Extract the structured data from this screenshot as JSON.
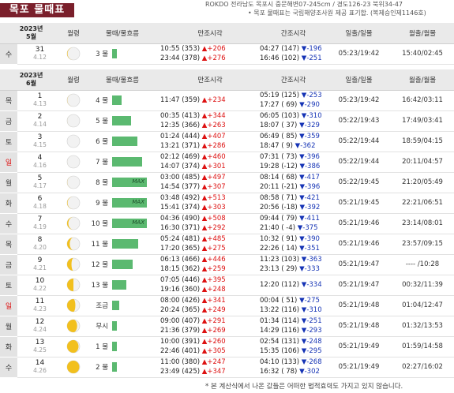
{
  "title": "목포 물때표",
  "header_info": "ROKDO 전라남도 목포시 중문해변07-245cm / 경도126-23 북위34-47",
  "header_note": "• 목포 물때표는 국립해양조사원 제공 표기합. (복제승인제1146호)",
  "columns": {
    "moon": "월령",
    "tide": "물때/물흐름",
    "high": "만조시각",
    "low": "간조시각",
    "sun": "일출/일몰",
    "moonrise": "월출/월몰"
  },
  "may": {
    "year": "2023년",
    "month": "5월",
    "rows": [
      {
        "dow": "수",
        "red": false,
        "solar": "31",
        "lunar": "4.12",
        "phase": 0.88,
        "tide": "3 물",
        "flow": 0.14,
        "max": "",
        "high1": "10:55 (353)",
        "hd1": "▲+206",
        "high2": "23:44 (378)",
        "hd2": "▲+276",
        "low1": "04:27 (147)",
        "ld1": "▼-196",
        "low2": "16:46 (102)",
        "ld2": "▼-251",
        "sun": "05:23/19:42",
        "moon": "15:40/02:45"
      }
    ]
  },
  "june": {
    "year": "2023년",
    "month": "6월",
    "rows": [
      {
        "dow": "목",
        "red": false,
        "solar": "1",
        "lunar": "4.13",
        "phase": 0.93,
        "tide": "4 물",
        "flow": 0.28,
        "max": "",
        "high1": "11:47 (359)",
        "hd1": "▲+234",
        "high2": "",
        "hd2": "",
        "low1": "05:19 (125)",
        "ld1": "▼-253",
        "low2": "17:27 ( 69)",
        "ld2": "▼-290",
        "sun": "05:23/19:42",
        "moon": "16:42/03:11"
      },
      {
        "dow": "금",
        "red": false,
        "solar": "2",
        "lunar": "4.14",
        "phase": 0.97,
        "tide": "5 물",
        "flow": 0.55,
        "max": "",
        "high1": "00:35 (413)",
        "hd1": "▲+344",
        "high2": "12:35 (366)",
        "hd2": "▲+263",
        "low1": "06:05 (103)",
        "ld1": "▼-310",
        "low2": "18:07 ( 37)",
        "ld2": "▼-329",
        "sun": "05:22/19:43",
        "moon": "17:49/03:41"
      },
      {
        "dow": "토",
        "red": false,
        "solar": "3",
        "lunar": "4.15",
        "phase": 1.0,
        "tide": "6 물",
        "flow": 0.72,
        "max": "",
        "high1": "01:24 (444)",
        "hd1": "▲+407",
        "high2": "13:21 (371)",
        "hd2": "▲+286",
        "low1": "06:49 ( 85)",
        "ld1": "▼-359",
        "low2": "18:47 (  9)",
        "ld2": "▼-362",
        "sun": "05:22/19:44",
        "moon": "18:59/04:15"
      },
      {
        "dow": "일",
        "red": true,
        "solar": "4",
        "lunar": "4.16",
        "phase": 0.98,
        "tide": "7 물",
        "flow": 0.86,
        "max": "",
        "high1": "02:12 (469)",
        "hd1": "▲+460",
        "high2": "14:07 (374)",
        "hd2": "▲+301",
        "low1": "07:31 ( 73)",
        "ld1": "▼-396",
        "low2": "19:28 (-12)",
        "ld2": "▼-386",
        "sun": "05:22/19:44",
        "moon": "20:11/04:57"
      },
      {
        "dow": "월",
        "red": false,
        "solar": "5",
        "lunar": "4.17",
        "phase": 0.94,
        "tide": "8 물",
        "flow": 1.0,
        "max": "MAX",
        "high1": "03:00 (485)",
        "hd1": "▲+497",
        "high2": "14:54 (377)",
        "hd2": "▲+307",
        "low1": "08:14 ( 68)",
        "ld1": "▼-417",
        "low2": "20:11 (-21)",
        "ld2": "▼-396",
        "sun": "05:22/19:45",
        "moon": "21:20/05:49"
      },
      {
        "dow": "화",
        "red": false,
        "solar": "6",
        "lunar": "4.18",
        "phase": 0.88,
        "tide": "9 물",
        "flow": 1.0,
        "max": "MAX",
        "high1": "03:48 (492)",
        "hd1": "▲+513",
        "high2": "15:41 (374)",
        "hd2": "▲+303",
        "low1": "08:58 ( 71)",
        "ld1": "▼-421",
        "low2": "20:56 (-18)",
        "ld2": "▼-392",
        "sun": "05:21/19:45",
        "moon": "22:21/06:51"
      },
      {
        "dow": "수",
        "red": false,
        "solar": "7",
        "lunar": "4.19",
        "phase": 0.8,
        "tide": "10 물",
        "flow": 1.0,
        "max": "MAX",
        "high1": "04:36 (490)",
        "hd1": "▲+508",
        "high2": "16:30 (371)",
        "hd2": "▲+292",
        "low1": "09:44 ( 79)",
        "ld1": "▼-411",
        "low2": "21:40 ( -4)",
        "ld2": "▼-375",
        "sun": "05:21/19:46",
        "moon": "23:14/08:01"
      },
      {
        "dow": "목",
        "red": false,
        "solar": "8",
        "lunar": "4.20",
        "phase": 0.7,
        "tide": "11 물",
        "flow": 0.75,
        "max": "",
        "high1": "05:24 (481)",
        "hd1": "▲+485",
        "high2": "17:20 (365)",
        "hd2": "▲+275",
        "low1": "10:32 ( 91)",
        "ld1": "▼-390",
        "low2": "22:26 ( 14)",
        "ld2": "▼-351",
        "sun": "05:21/19:46",
        "moon": "23:57/09:15"
      },
      {
        "dow": "금",
        "red": false,
        "solar": "9",
        "lunar": "4.21",
        "phase": 0.6,
        "tide": "12 물",
        "flow": 0.6,
        "max": "",
        "high1": "06:13 (466)",
        "hd1": "▲+446",
        "high2": "18:15 (362)",
        "hd2": "▲+259",
        "low1": "11:23 (103)",
        "ld1": "▼-363",
        "low2": "23:13 ( 29)",
        "ld2": "▼-333",
        "sun": "05:21/19:47",
        "moon": "---- /10:28"
      },
      {
        "dow": "토",
        "red": false,
        "solar": "10",
        "lunar": "4.22",
        "phase": 0.5,
        "tide": "13 물",
        "flow": 0.42,
        "max": "",
        "high1": "07:05 (446)",
        "hd1": "▲+395",
        "high2": "19:16 (360)",
        "hd2": "▲+248",
        "low1": "12:20 (112)",
        "ld1": "▼-334",
        "low2": "",
        "ld2": "",
        "sun": "05:21/19:47",
        "moon": "00:32/11:39"
      },
      {
        "dow": "일",
        "red": true,
        "solar": "11",
        "lunar": "4.23",
        "phase": 0.4,
        "tide": "조금",
        "flow": 0.2,
        "max": "",
        "high1": "08:00 (426)",
        "hd1": "▲+341",
        "high2": "20:24 (365)",
        "hd2": "▲+249",
        "low1": "00:04 ( 51)",
        "ld1": "▼-275",
        "low2": "13:22 (116)",
        "ld2": "▼-310",
        "sun": "05:21/19:48",
        "moon": "01:04/12:47"
      },
      {
        "dow": "월",
        "red": false,
        "solar": "12",
        "lunar": "4.24",
        "phase": 0.3,
        "tide": "무시",
        "flow": 0.14,
        "max": "",
        "high1": "09:00 (407)",
        "hd1": "▲+291",
        "high2": "21:36 (379)",
        "hd2": "▲+269",
        "low1": "01:34 (114)",
        "ld1": "▼-251",
        "low2": "14:29 (116)",
        "ld2": "▼-293",
        "sun": "05:21/19:48",
        "moon": "01:32/13:53"
      },
      {
        "dow": "화",
        "red": false,
        "solar": "13",
        "lunar": "4.25",
        "phase": 0.2,
        "tide": "1 물",
        "flow": 0.14,
        "max": "",
        "high1": "10:00 (391)",
        "hd1": "▲+260",
        "high2": "22:46 (401)",
        "hd2": "▲+305",
        "low1": "02:54 (131)",
        "ld1": "▼-248",
        "low2": "15:35 (106)",
        "ld2": "▼-295",
        "sun": "05:21/19:49",
        "moon": "01:59/14:58"
      },
      {
        "dow": "수",
        "red": false,
        "solar": "14",
        "lunar": "4.26",
        "phase": 0.12,
        "tide": "2 물",
        "flow": 0.14,
        "max": "",
        "high1": "11:00 (380)",
        "hd1": "▲+247",
        "high2": "23:49 (425)",
        "hd2": "▲+347",
        "low1": "04:10 (133)",
        "ld1": "▼-268",
        "low2": "16:32 ( 78)",
        "ld2": "▼-302",
        "sun": "05:21/19:49",
        "moon": "02:27/16:02"
      }
    ]
  },
  "footer": "* 본 계산식에서 나온 값들은 어떠한 법적효력도 가지고 있지 않습니다."
}
